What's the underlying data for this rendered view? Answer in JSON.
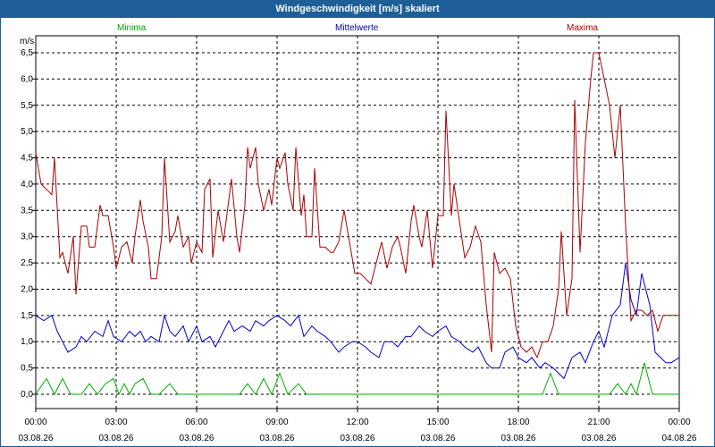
{
  "window": {
    "title": "Windgeschwindigkeit [m/s] skaliert"
  },
  "chart_data": {
    "type": "line",
    "title": "Windgeschwindigkeit [m/s] skaliert",
    "ylabel": "m/s",
    "ylim": [
      0,
      6.5
    ],
    "xlim": [
      0,
      24
    ],
    "grid": true,
    "legend_placement": "top",
    "y_ticks": [
      "0,0",
      "0,5",
      "1,0",
      "1,5",
      "2,0",
      "2,5",
      "3,0",
      "3,5",
      "4,0",
      "4,5",
      "5,0",
      "5,5",
      "6,0",
      "6,5"
    ],
    "x_ticks": [
      {
        "time": "00:00",
        "date": "03.08.26"
      },
      {
        "time": "03:00",
        "date": "03.08.26"
      },
      {
        "time": "06:00",
        "date": "03.08.26"
      },
      {
        "time": "09:00",
        "date": "03.08.26"
      },
      {
        "time": "12:00",
        "date": "03.08.26"
      },
      {
        "time": "15:00",
        "date": "03.08.26"
      },
      {
        "time": "18:00",
        "date": "03.08.26"
      },
      {
        "time": "21:00",
        "date": "03.08.26"
      },
      {
        "time": "00:00",
        "date": "04.08.26"
      }
    ],
    "series": [
      {
        "name": "Minima",
        "color": "#00aa00",
        "points": [
          [
            0,
            0.0
          ],
          [
            0.4,
            0.3
          ],
          [
            0.7,
            0.0
          ],
          [
            1.0,
            0.3
          ],
          [
            1.3,
            0.0
          ],
          [
            1.7,
            0.0
          ],
          [
            2.0,
            0.2
          ],
          [
            2.3,
            0.0
          ],
          [
            2.6,
            0.2
          ],
          [
            2.9,
            0.3
          ],
          [
            3.1,
            0.0
          ],
          [
            3.3,
            0.2
          ],
          [
            3.5,
            0.0
          ],
          [
            3.7,
            0.2
          ],
          [
            4.0,
            0.3
          ],
          [
            4.3,
            0.0
          ],
          [
            4.6,
            0.0
          ],
          [
            5.0,
            0.2
          ],
          [
            5.3,
            0.0
          ],
          [
            5.6,
            0.0
          ],
          [
            7.6,
            0.0
          ],
          [
            7.9,
            0.2
          ],
          [
            8.2,
            0.0
          ],
          [
            8.5,
            0.3
          ],
          [
            8.8,
            0.0
          ],
          [
            9.1,
            0.4
          ],
          [
            9.4,
            0.0
          ],
          [
            9.8,
            0.2
          ],
          [
            10.1,
            0.0
          ],
          [
            18.9,
            0.0
          ],
          [
            19.2,
            0.4
          ],
          [
            19.5,
            0.0
          ],
          [
            21.4,
            0.0
          ],
          [
            21.7,
            0.2
          ],
          [
            22.0,
            0.0
          ],
          [
            22.2,
            0.2
          ],
          [
            22.4,
            0.0
          ],
          [
            22.7,
            0.6
          ],
          [
            23.0,
            0.0
          ],
          [
            24,
            0.0
          ]
        ]
      },
      {
        "name": "Mittelwerte",
        "color": "#0000cc",
        "points": [
          [
            0,
            1.5
          ],
          [
            0.3,
            1.4
          ],
          [
            0.6,
            1.5
          ],
          [
            0.8,
            1.2
          ],
          [
            1.0,
            1.0
          ],
          [
            1.2,
            0.8
          ],
          [
            1.5,
            0.9
          ],
          [
            1.7,
            1.1
          ],
          [
            1.9,
            1.0
          ],
          [
            2.2,
            1.2
          ],
          [
            2.5,
            1.1
          ],
          [
            2.7,
            1.4
          ],
          [
            2.9,
            1.1
          ],
          [
            3.2,
            1.0
          ],
          [
            3.5,
            1.2
          ],
          [
            3.7,
            1.1
          ],
          [
            3.9,
            1.2
          ],
          [
            4.1,
            1.0
          ],
          [
            4.3,
            1.1
          ],
          [
            4.6,
            1.0
          ],
          [
            4.8,
            1.5
          ],
          [
            5.0,
            1.2
          ],
          [
            5.2,
            1.1
          ],
          [
            5.5,
            1.3
          ],
          [
            5.7,
            1.0
          ],
          [
            6.0,
            1.3
          ],
          [
            6.2,
            1.0
          ],
          [
            6.5,
            1.1
          ],
          [
            6.7,
            0.9
          ],
          [
            7.0,
            1.2
          ],
          [
            7.2,
            1.4
          ],
          [
            7.4,
            1.2
          ],
          [
            7.7,
            1.3
          ],
          [
            8.0,
            1.2
          ],
          [
            8.2,
            1.4
          ],
          [
            8.5,
            1.3
          ],
          [
            8.7,
            1.4
          ],
          [
            9.0,
            1.5
          ],
          [
            9.3,
            1.4
          ],
          [
            9.5,
            1.3
          ],
          [
            9.8,
            1.5
          ],
          [
            10.0,
            1.1
          ],
          [
            10.3,
            1.3
          ],
          [
            10.5,
            1.2
          ],
          [
            10.8,
            1.1
          ],
          [
            11.0,
            1.0
          ],
          [
            11.3,
            0.8
          ],
          [
            11.5,
            0.9
          ],
          [
            11.8,
            1.0
          ],
          [
            12.0,
            1.0
          ],
          [
            12.3,
            0.9
          ],
          [
            12.5,
            0.8
          ],
          [
            12.8,
            0.7
          ],
          [
            13.0,
            1.0
          ],
          [
            13.3,
            1.0
          ],
          [
            13.5,
            0.9
          ],
          [
            13.8,
            1.1
          ],
          [
            14.0,
            1.1
          ],
          [
            14.3,
            1.3
          ],
          [
            14.5,
            1.2
          ],
          [
            14.8,
            1.1
          ],
          [
            15.0,
            1.2
          ],
          [
            15.3,
            1.3
          ],
          [
            15.5,
            1.1
          ],
          [
            15.8,
            1.0
          ],
          [
            16.0,
            0.9
          ],
          [
            16.3,
            0.8
          ],
          [
            16.5,
            0.9
          ],
          [
            16.8,
            0.6
          ],
          [
            17.0,
            0.5
          ],
          [
            17.3,
            0.5
          ],
          [
            17.5,
            0.8
          ],
          [
            17.8,
            0.9
          ],
          [
            18.0,
            0.7
          ],
          [
            18.3,
            0.6
          ],
          [
            18.5,
            0.7
          ],
          [
            18.8,
            0.5
          ],
          [
            19.0,
            0.6
          ],
          [
            19.3,
            0.5
          ],
          [
            19.5,
            0.4
          ],
          [
            19.7,
            0.3
          ],
          [
            20.0,
            0.7
          ],
          [
            20.3,
            0.8
          ],
          [
            20.5,
            0.6
          ],
          [
            20.8,
            1.0
          ],
          [
            21.0,
            1.2
          ],
          [
            21.2,
            0.9
          ],
          [
            21.5,
            1.5
          ],
          [
            21.8,
            1.7
          ],
          [
            22.0,
            2.5
          ],
          [
            22.2,
            1.8
          ],
          [
            22.4,
            1.5
          ],
          [
            22.6,
            2.3
          ],
          [
            22.9,
            1.7
          ],
          [
            23.1,
            0.8
          ],
          [
            23.3,
            0.7
          ],
          [
            23.5,
            0.6
          ],
          [
            23.7,
            0.6
          ],
          [
            24,
            0.7
          ]
        ]
      },
      {
        "name": "Maxima",
        "color": "#aa0000",
        "points": [
          [
            0,
            4.6
          ],
          [
            0.2,
            4.0
          ],
          [
            0.4,
            3.9
          ],
          [
            0.6,
            3.8
          ],
          [
            0.7,
            4.5
          ],
          [
            0.9,
            2.6
          ],
          [
            1.0,
            2.7
          ],
          [
            1.1,
            2.5
          ],
          [
            1.2,
            2.3
          ],
          [
            1.4,
            3.0
          ],
          [
            1.5,
            1.9
          ],
          [
            1.7,
            3.2
          ],
          [
            1.9,
            3.2
          ],
          [
            2.0,
            2.8
          ],
          [
            2.2,
            2.8
          ],
          [
            2.4,
            3.6
          ],
          [
            2.5,
            3.4
          ],
          [
            2.7,
            3.4
          ],
          [
            2.9,
            2.8
          ],
          [
            3.0,
            2.4
          ],
          [
            3.2,
            2.8
          ],
          [
            3.4,
            2.9
          ],
          [
            3.6,
            2.5
          ],
          [
            3.7,
            3.0
          ],
          [
            3.9,
            3.7
          ],
          [
            4.0,
            3.3
          ],
          [
            4.2,
            2.8
          ],
          [
            4.3,
            2.2
          ],
          [
            4.5,
            2.2
          ],
          [
            4.7,
            3.0
          ],
          [
            4.8,
            4.5
          ],
          [
            5.0,
            2.9
          ],
          [
            5.2,
            3.1
          ],
          [
            5.3,
            3.4
          ],
          [
            5.5,
            2.8
          ],
          [
            5.7,
            3.0
          ],
          [
            5.8,
            2.5
          ],
          [
            6.0,
            2.9
          ],
          [
            6.2,
            2.7
          ],
          [
            6.3,
            3.9
          ],
          [
            6.5,
            4.1
          ],
          [
            6.6,
            2.6
          ],
          [
            6.8,
            3.5
          ],
          [
            7.0,
            2.9
          ],
          [
            7.2,
            3.7
          ],
          [
            7.3,
            4.1
          ],
          [
            7.5,
            3.0
          ],
          [
            7.6,
            2.7
          ],
          [
            7.8,
            3.6
          ],
          [
            7.9,
            4.7
          ],
          [
            8.0,
            4.3
          ],
          [
            8.2,
            4.7
          ],
          [
            8.3,
            4.0
          ],
          [
            8.5,
            3.5
          ],
          [
            8.7,
            3.9
          ],
          [
            8.8,
            3.6
          ],
          [
            9.0,
            4.5
          ],
          [
            9.1,
            4.3
          ],
          [
            9.3,
            4.6
          ],
          [
            9.4,
            4.0
          ],
          [
            9.6,
            3.5
          ],
          [
            9.7,
            4.7
          ],
          [
            9.9,
            3.4
          ],
          [
            10.0,
            3.8
          ],
          [
            10.1,
            3.0
          ],
          [
            10.3,
            3.0
          ],
          [
            10.4,
            4.3
          ],
          [
            10.6,
            2.8
          ],
          [
            10.8,
            2.8
          ],
          [
            11.0,
            2.7
          ],
          [
            11.1,
            2.7
          ],
          [
            11.3,
            2.9
          ],
          [
            11.5,
            3.5
          ],
          [
            11.7,
            2.9
          ],
          [
            11.9,
            2.3
          ],
          [
            12.1,
            2.3
          ],
          [
            12.3,
            2.2
          ],
          [
            12.5,
            2.1
          ],
          [
            12.6,
            2.3
          ],
          [
            12.8,
            2.7
          ],
          [
            12.9,
            2.9
          ],
          [
            13.1,
            2.4
          ],
          [
            13.3,
            2.8
          ],
          [
            13.5,
            3.0
          ],
          [
            13.6,
            2.8
          ],
          [
            13.8,
            2.3
          ],
          [
            14.0,
            3.3
          ],
          [
            14.1,
            3.6
          ],
          [
            14.3,
            3.0
          ],
          [
            14.4,
            2.8
          ],
          [
            14.6,
            3.5
          ],
          [
            14.8,
            2.4
          ],
          [
            15.0,
            3.4
          ],
          [
            15.2,
            3.4
          ],
          [
            15.3,
            5.4
          ],
          [
            15.5,
            3.4
          ],
          [
            15.6,
            4.0
          ],
          [
            15.8,
            3.3
          ],
          [
            16.0,
            2.6
          ],
          [
            16.2,
            2.8
          ],
          [
            16.4,
            3.2
          ],
          [
            16.6,
            2.9
          ],
          [
            16.8,
            1.7
          ],
          [
            17.0,
            0.8
          ],
          [
            17.1,
            2.7
          ],
          [
            17.3,
            2.3
          ],
          [
            17.5,
            2.4
          ],
          [
            17.7,
            2.2
          ],
          [
            17.9,
            1.3
          ],
          [
            18.1,
            0.9
          ],
          [
            18.3,
            0.8
          ],
          [
            18.5,
            0.9
          ],
          [
            18.7,
            0.7
          ],
          [
            18.9,
            1.0
          ],
          [
            19.1,
            1.0
          ],
          [
            19.3,
            1.3
          ],
          [
            19.5,
            2.0
          ],
          [
            19.6,
            3.1
          ],
          [
            19.8,
            1.5
          ],
          [
            20.0,
            2.2
          ],
          [
            20.1,
            5.6
          ],
          [
            20.3,
            2.7
          ],
          [
            20.5,
            4.8
          ],
          [
            20.7,
            6.0
          ],
          [
            20.8,
            6.5
          ],
          [
            21.0,
            6.5
          ],
          [
            21.2,
            6.0
          ],
          [
            21.4,
            5.5
          ],
          [
            21.6,
            4.5
          ],
          [
            21.8,
            5.5
          ],
          [
            22.0,
            3.2
          ],
          [
            22.2,
            1.4
          ],
          [
            22.4,
            1.6
          ],
          [
            22.6,
            1.6
          ],
          [
            22.8,
            1.5
          ],
          [
            23.0,
            1.6
          ],
          [
            23.2,
            1.2
          ],
          [
            23.4,
            1.5
          ],
          [
            24,
            1.5
          ]
        ]
      }
    ]
  }
}
